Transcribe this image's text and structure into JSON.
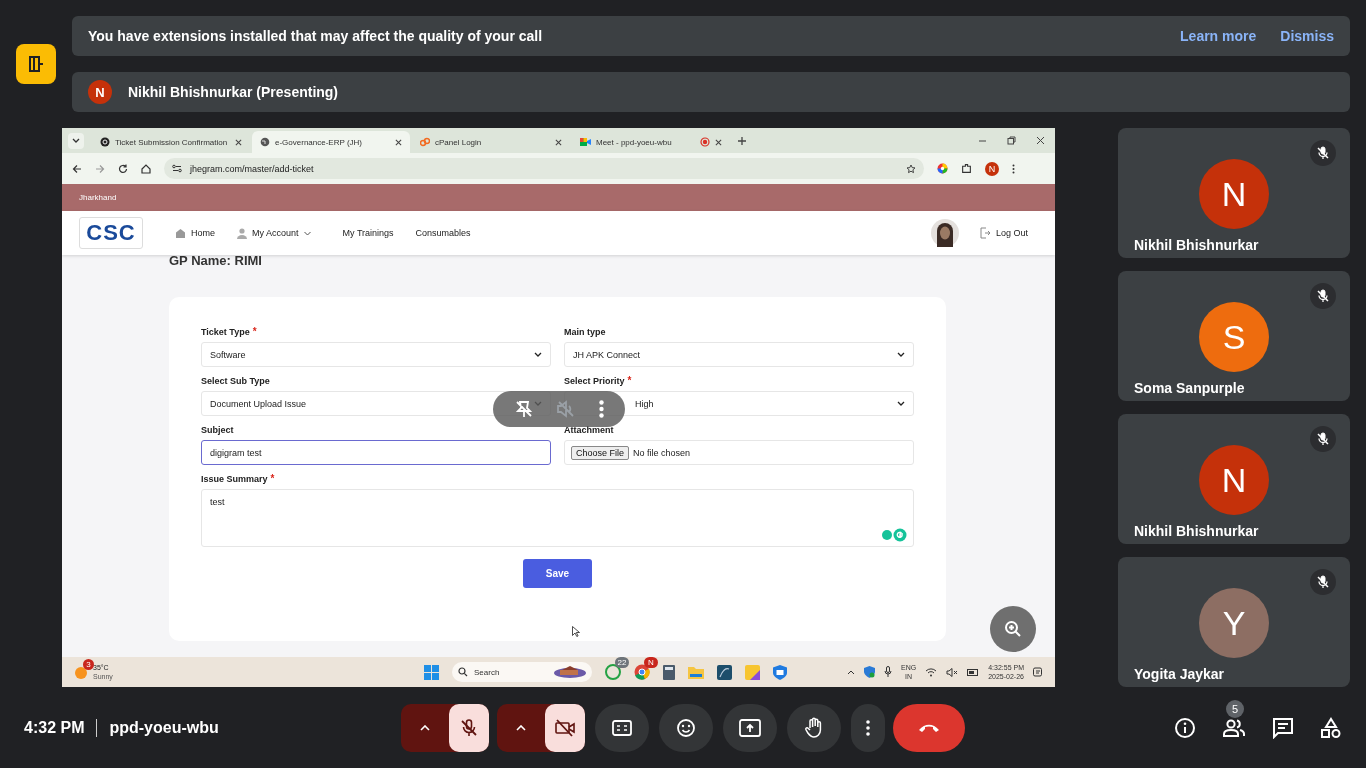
{
  "banner": {
    "message": "You have extensions installed that may affect the quality of your call",
    "links": [
      "Learn more",
      "Dismiss"
    ]
  },
  "presenter": {
    "initial": "N",
    "name": "Nikhil Bhishnurkar (Presenting)"
  },
  "shared_screen": {
    "tabs": [
      {
        "title": "Ticket Submission Confirmation",
        "selected": false,
        "kind": "ring"
      },
      {
        "title": "e-Governance-ERP (JH)",
        "selected": true,
        "kind": "globe"
      },
      {
        "title": "cPanel Login",
        "selected": false,
        "kind": "cpanel"
      },
      {
        "title": "Meet - ppd-yoeu-wbu",
        "selected": false,
        "kind": "meet",
        "recording": true
      }
    ],
    "url": "jhegram.com/master/add-ticket",
    "profile_initial": "N",
    "region": "Jharkhand",
    "logo": "CSC",
    "nav": [
      {
        "label": "Home",
        "kind": "home"
      },
      {
        "label": "My Account",
        "kind": "account"
      },
      {
        "label": "My Trainings",
        "kind": "plain"
      },
      {
        "label": "Consumables",
        "kind": "plain"
      }
    ],
    "logout": "Log Out",
    "gp_name": "GP Name: RIMI",
    "fields": [
      {
        "label": "Ticket Type",
        "required_mark": "*",
        "kind": "select",
        "value": "Software"
      },
      {
        "label": "Main type",
        "kind": "select",
        "value": "JH APK Connect"
      },
      {
        "label": "Select Sub Type",
        "kind": "select",
        "value": "Document Upload Issue"
      },
      {
        "label": "Select Priority",
        "required_mark": "*",
        "kind": "select",
        "value": "High"
      },
      {
        "label": "Subject",
        "kind": "text",
        "value": "digigram test",
        "focused": true
      },
      {
        "label": "Attachment",
        "kind": "file",
        "button": "Choose File",
        "value": "No file chosen"
      },
      {
        "label": "Issue Summary",
        "required_mark": "*",
        "kind": "textarea",
        "value": "test"
      }
    ],
    "save": "Save",
    "taskbar": {
      "weather_badge": "3",
      "temperature": "35°C",
      "condition": "Sunny",
      "search_placeholder": "Search",
      "whatsapp_badge": "22",
      "chrome_badge": "N",
      "language": "ENG",
      "region": "IN",
      "time": "4:32:55 PM",
      "date": "2025-02-26"
    }
  },
  "participants": [
    {
      "initial": "N",
      "name": "Nikhil Bhishnurkar",
      "color": "#c5310a",
      "muted": true
    },
    {
      "initial": "S",
      "name": "Soma Sanpurple",
      "color": "#ee6c0e",
      "muted": true
    },
    {
      "initial": "N",
      "name": "Nikhil Bhishnurkar",
      "color": "#c5310a",
      "muted": true
    },
    {
      "initial": "Y",
      "name": "Yogita Jaykar",
      "color": "#8d6e63",
      "muted": true
    }
  ],
  "footer": {
    "time": "4:32 PM",
    "meeting_code": "ppd-yoeu-wbu",
    "mic_on": false,
    "camera_on": false,
    "people_count": "5"
  }
}
